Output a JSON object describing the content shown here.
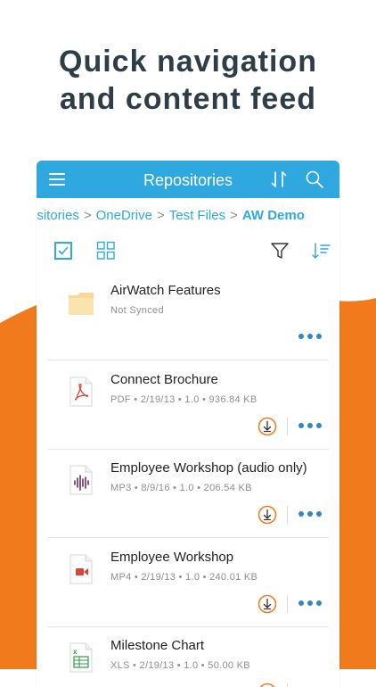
{
  "headline": {
    "line1": "Quick navigation",
    "line2": "and content feed"
  },
  "appbar": {
    "title": "Repositories",
    "menu_icon": "hamburger-menu-icon",
    "sort_icon": "sort-arrows-icon",
    "search_icon": "search-icon"
  },
  "breadcrumb": {
    "items": [
      "ositories",
      "OneDrive",
      "Test Files"
    ],
    "separator": ">",
    "current": "AW Demo"
  },
  "toolbar": {
    "icons": [
      "select-checkbox-icon",
      "grid-view-icon",
      "filter-icon",
      "sort-list-icon"
    ]
  },
  "files": [
    {
      "name": "AirWatch Features",
      "meta": "Not Synced",
      "icon": "folder-icon",
      "downloadable": false
    },
    {
      "name": "Connect Brochure",
      "meta": "PDF • 2/19/13 • 1.0 • 936.84 KB",
      "icon": "pdf-file-icon",
      "downloadable": true
    },
    {
      "name": "Employee Workshop (audio only)",
      "meta": "MP3 • 8/9/16 • 1.0 • 206.54 KB",
      "icon": "audio-file-icon",
      "downloadable": true
    },
    {
      "name": "Employee Workshop",
      "meta": "MP4 • 2/19/13 • 1.0 • 240.01 KB",
      "icon": "video-file-icon",
      "downloadable": true
    },
    {
      "name": "Milestone Chart",
      "meta": "XLS • 2/19/13 • 1.0 • 50.00 KB",
      "icon": "spreadsheet-file-icon",
      "downloadable": true
    }
  ],
  "colors": {
    "accent_blue": "#2fa8df",
    "orange": "#f07a1c",
    "headline": "#2f3d47",
    "more_dots": "#2f86c9"
  }
}
